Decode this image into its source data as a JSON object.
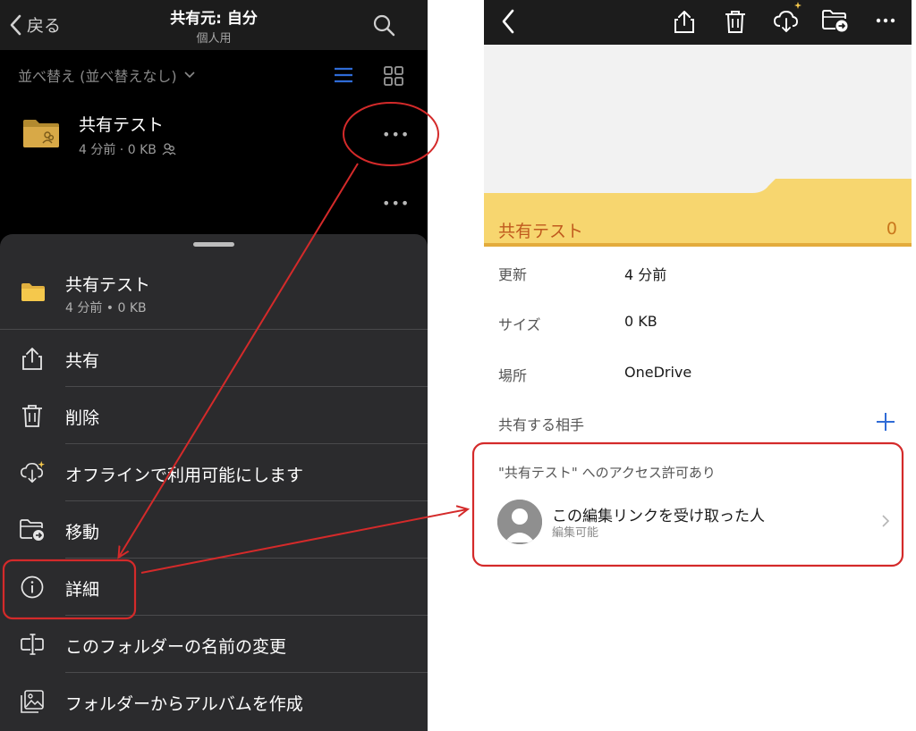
{
  "left": {
    "nav": {
      "back_label": "戻る",
      "title": "共有元: 自分",
      "subtitle": "個人用"
    },
    "sort_label": "並べ替え (並べ替えなし)",
    "folder": {
      "name": "共有テスト",
      "meta": "4 分前 · 0 KB",
      "more": "•••"
    },
    "second_more": "•••",
    "sheet": {
      "name": "共有テスト",
      "meta": "4 分前 • 0 KB",
      "items": [
        {
          "label": "共有",
          "icon": "share-icon"
        },
        {
          "label": "削除",
          "icon": "trash-icon"
        },
        {
          "label": "オフラインで利用可能にします",
          "icon": "cloud-download-icon"
        },
        {
          "label": "移動",
          "icon": "move-folder-icon"
        },
        {
          "label": "詳細",
          "icon": "info-icon"
        },
        {
          "label": "このフォルダーの名前の変更",
          "icon": "rename-icon"
        },
        {
          "label": "フォルダーからアルバムを作成",
          "icon": "album-icon"
        }
      ]
    }
  },
  "right": {
    "preview": {
      "folder_title": "共有テスト",
      "count": "0"
    },
    "properties": [
      {
        "label": "更新",
        "value": "4 分前"
      },
      {
        "label": "サイズ",
        "value": "0 KB"
      },
      {
        "label": "場所",
        "value": "OneDrive"
      }
    ],
    "share_label": "共有する相手",
    "access": {
      "title": "\"共有テスト\" へのアクセス許可あり",
      "name": "この編集リンクを受け取った人",
      "permission": "編集可能"
    }
  },
  "colors": {
    "annotation_red": "#d42a2a",
    "folder_yellow": "#f7d66f",
    "sheet_bg": "#2b2b2d",
    "accent_blue": "#2f6bd6"
  }
}
